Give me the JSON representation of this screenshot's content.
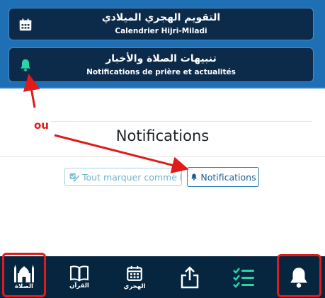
{
  "menu": {
    "calendar_card": {
      "title_ar": "التقويم الهجري الميلادي",
      "title_fr": "Calendrier Hijri-Miladi",
      "icon": "calendar-icon"
    },
    "notifications_card": {
      "title_ar": "تنبيهات الصلاة والأخبار",
      "title_fr": "Notifications de prière et actualités",
      "icon": "bell-icon"
    }
  },
  "annotation": {
    "ou_label": "ou",
    "color": "#e01b1b"
  },
  "page": {
    "title": "Notifications",
    "mark_all_read_label": "Tout marquer comme lu",
    "notifications_button_label": "Notifications"
  },
  "bottom_nav": {
    "items": [
      {
        "label": "الصلاة",
        "icon": "mosque-icon",
        "highlighted": true
      },
      {
        "label": "القرآن",
        "icon": "book-icon"
      },
      {
        "label": "الهجري",
        "icon": "calendar-icon"
      },
      {
        "label": "",
        "icon": "share-icon"
      },
      {
        "label": "",
        "icon": "checklist-icon"
      },
      {
        "label": "",
        "icon": "bell-icon",
        "highlighted": true
      }
    ]
  },
  "colors": {
    "top_background": "#1e6fb4",
    "card_background": "#0c2a4a",
    "nav_background": "#06263f",
    "accent_green": "#2ad4a6",
    "button_blue": "#1a5f99"
  }
}
